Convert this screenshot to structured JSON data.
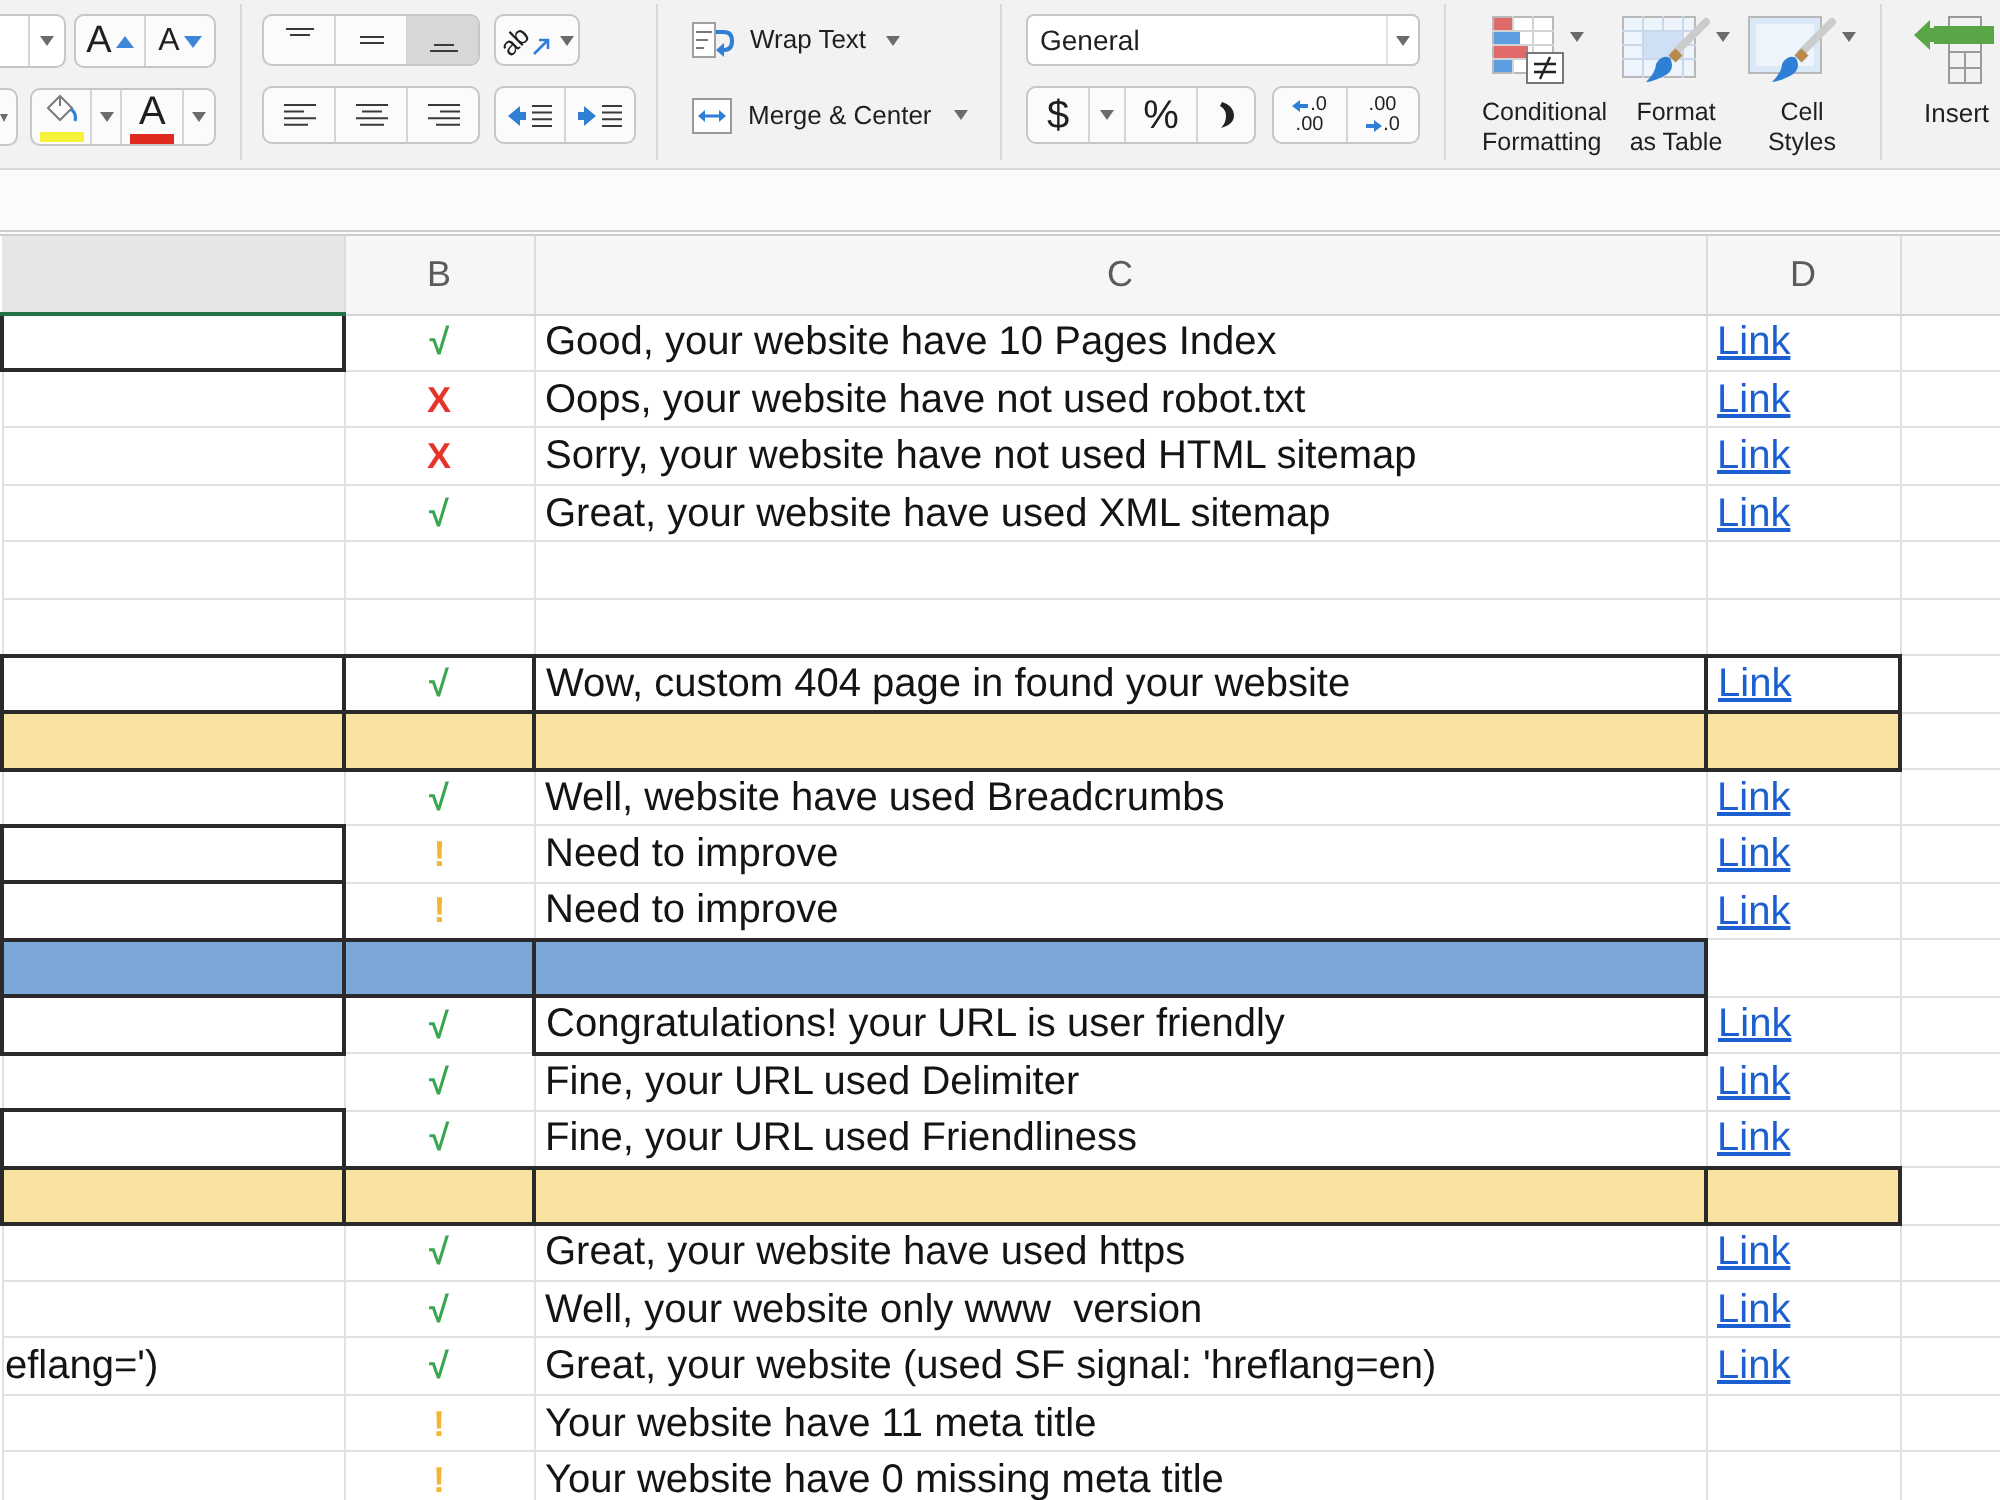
{
  "ribbon": {
    "font_size_buttons": [
      {
        "kind": "grow",
        "label": "A"
      },
      {
        "kind": "shrink",
        "label": "A"
      }
    ],
    "font_color_button": {
      "label": "A"
    },
    "vertical_align": [
      {
        "kind": "top",
        "selected": false
      },
      {
        "kind": "middle",
        "selected": false
      },
      {
        "kind": "bottom",
        "selected": true
      }
    ],
    "orientation_button": {
      "label": "ab"
    },
    "horizontal_align": [
      {
        "kind": "left",
        "selected": false
      },
      {
        "kind": "center",
        "selected": false
      },
      {
        "kind": "right",
        "selected": false
      }
    ],
    "wrap_text_button": {
      "label": "Wrap Text"
    },
    "merge_button": {
      "label": "Merge & Center"
    },
    "number_format": {
      "value": "General"
    },
    "number_buttons": [
      {
        "kind": "currency",
        "label": "$"
      },
      {
        "kind": "percent",
        "label": "%"
      }
    ],
    "decimal_buttons": [
      {
        "kind": "increase",
        "top": ".0",
        "bottom": ".00"
      },
      {
        "kind": "decrease",
        "top": ".00",
        "bottom": ".0"
      }
    ],
    "style_buttons": [
      {
        "kind": "conditional",
        "label": "Conditional Formatting"
      },
      {
        "kind": "table",
        "label": "Format as Table"
      },
      {
        "kind": "cell",
        "label": "Cell Styles"
      },
      {
        "kind": "insert",
        "label": "Insert"
      }
    ]
  },
  "sheet": {
    "columns": [
      {
        "selected": true
      },
      {
        "label": "B",
        "selected": false
      },
      {
        "label": "C",
        "selected": false
      },
      {
        "label": "D",
        "selected": false
      },
      {
        "selected": false
      }
    ],
    "rows": [
      {
        "kind": "check",
        "color": "#3aa64f",
        "mark": "√",
        "text": "Good, your website have 10 Pages Index",
        "link": "Link",
        "cells": [
          {
            "outlined": true
          },
          {
            "outlined": false
          },
          {
            "outlined": false
          },
          {
            "outlined": false
          }
        ]
      },
      {
        "kind": "check",
        "color": "#e5352b",
        "mark": "X",
        "text": "Oops, your website have not used robot.txt",
        "link": "Link"
      },
      {
        "kind": "check",
        "color": "#e5352b",
        "mark": "X",
        "text": "Sorry, your website have not used HTML sitemap",
        "link": "Link"
      },
      {
        "kind": "check",
        "color": "#3aa64f",
        "mark": "√",
        "text": "Great, your website have used XML sitemap",
        "link": "Link"
      },
      {
        "kind": "empty"
      },
      {
        "kind": "empty"
      },
      {
        "kind": "check",
        "color": "#3aa64f",
        "mark": "√",
        "text": "Wow, custom 404 page in found your website",
        "link": "Link",
        "cells": [
          {
            "outlined": true
          },
          {
            "outlined": true
          },
          {
            "outlined": true
          },
          {
            "outlined": true
          }
        ]
      },
      {
        "kind": "band",
        "color": "#f9e3a3",
        "cells": [
          {
            "outlined": true,
            "filled": true
          },
          {
            "outlined": true,
            "filled": true
          },
          {
            "outlined": true,
            "filled": true
          },
          {
            "outlined": true,
            "filled": true
          }
        ]
      },
      {
        "kind": "check",
        "color": "#3aa64f",
        "mark": "√",
        "text": "Well, website have used Breadcrumbs",
        "link": "Link"
      },
      {
        "kind": "check",
        "color": "#f3b634",
        "mark": "!",
        "text": "Need to improve",
        "link": "Link",
        "cells": [
          {
            "outlined": true
          },
          {
            "outlined": false
          },
          {
            "outlined": false
          },
          {
            "outlined": false
          }
        ]
      },
      {
        "kind": "check",
        "color": "#f3b634",
        "mark": "!",
        "text": "Need to improve",
        "link": "Link",
        "cells": [
          {
            "outlined": true
          },
          {
            "outlined": false
          },
          {
            "outlined": false
          },
          {
            "outlined": false
          }
        ]
      },
      {
        "kind": "band",
        "color": "#7ba7d8",
        "cells": [
          {
            "outlined": true,
            "filled": true
          },
          {
            "outlined": true,
            "filled": true
          },
          {
            "outlined": true,
            "filled": true
          },
          {
            "outlined": false,
            "filled": false
          }
        ]
      },
      {
        "kind": "check",
        "color": "#3aa64f",
        "mark": "√",
        "text": "Congratulations! your URL is user friendly",
        "link": "Link",
        "cells": [
          {
            "outlined": true
          },
          {
            "outlined": false
          },
          {
            "outlined": true
          },
          {
            "outlined": false
          }
        ]
      },
      {
        "kind": "check",
        "color": "#3aa64f",
        "mark": "√",
        "text": "Fine, your URL used Delimiter",
        "link": "Link"
      },
      {
        "kind": "check",
        "color": "#3aa64f",
        "mark": "√",
        "text": "Fine, your URL used Friendliness",
        "link": "Link",
        "cells": [
          {
            "outlined": true
          },
          {
            "outlined": false
          },
          {
            "outlined": false
          },
          {
            "outlined": false
          }
        ]
      },
      {
        "kind": "band",
        "color": "#f9e3a3",
        "cells": [
          {
            "outlined": true,
            "filled": true
          },
          {
            "outlined": true,
            "filled": true
          },
          {
            "outlined": true,
            "filled": true
          },
          {
            "outlined": true,
            "filled": true
          }
        ]
      },
      {
        "kind": "check",
        "color": "#3aa64f",
        "mark": "√",
        "text": "Great, your website have used https",
        "link": "Link"
      },
      {
        "kind": "check",
        "color": "#3aa64f",
        "mark": "√",
        "text": "Well, your website only www  version",
        "link": "Link"
      },
      {
        "kind": "check",
        "color": "#3aa64f",
        "mark": "√",
        "cell_a": "eflang=')",
        "text": "Great, your website (used SF signal: 'hreflang=en)",
        "link": "Link"
      },
      {
        "kind": "check",
        "color": "#f3b634",
        "mark": "!",
        "text": "Your website have 11 meta title"
      },
      {
        "kind": "check",
        "color": "#f3b634",
        "mark": "!",
        "text": "Your website have 0 missing meta title"
      }
    ]
  }
}
